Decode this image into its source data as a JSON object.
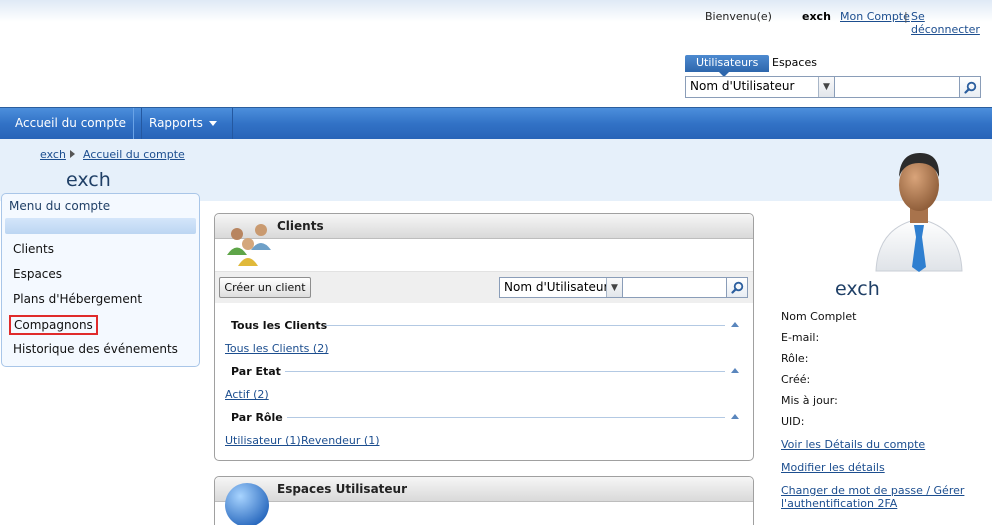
{
  "header": {
    "welcome": "Bienvenu(e)",
    "username": "exch",
    "account_link": "Mon Compte",
    "separator": "|",
    "logout_link": "Se déconnecter",
    "search_tabs": [
      "Utilisateurs",
      "Espaces"
    ],
    "search_select": "Nom d'Utilisateur",
    "search_input": ""
  },
  "nav": {
    "home": "Accueil du compte",
    "reports": "Rapports"
  },
  "breadcrumb": [
    "exch",
    "Accueil du compte"
  ],
  "page_title": "exch",
  "left_menu": {
    "title": "Menu du compte",
    "items": [
      "Clients",
      "Espaces",
      "Plans d'Hébergement",
      "Compagnons",
      "Historique des événements"
    ]
  },
  "clients": {
    "title": "Clients",
    "create_button": "Créer un client",
    "select": "Nom d'Utilisateur",
    "search_input": "",
    "groups": [
      {
        "title": "Tous les Clients",
        "links": [
          "Tous les Clients (2)"
        ]
      },
      {
        "title": "Par Etat",
        "links": [
          "Actif (2)"
        ]
      },
      {
        "title": "Par Rôle",
        "links": [
          "Utilisateur (1)",
          "Revendeur (1)"
        ]
      }
    ]
  },
  "spaces_panel": {
    "title": "Espaces Utilisateur"
  },
  "profile": {
    "name": "exch",
    "labels": [
      "Nom Complet",
      "E-mail:",
      "Rôle:",
      "Créé:",
      "Mis à jour:",
      "UID:"
    ],
    "links": [
      "Voir les Détails du compte",
      "Modifier les détails",
      "Changer de mot de passe / Gérer l'authentification 2FA"
    ]
  },
  "colors": {
    "nav_blue": "#3272c6",
    "link": "#1c4e8f",
    "highlight_border": "#e02b2b"
  }
}
